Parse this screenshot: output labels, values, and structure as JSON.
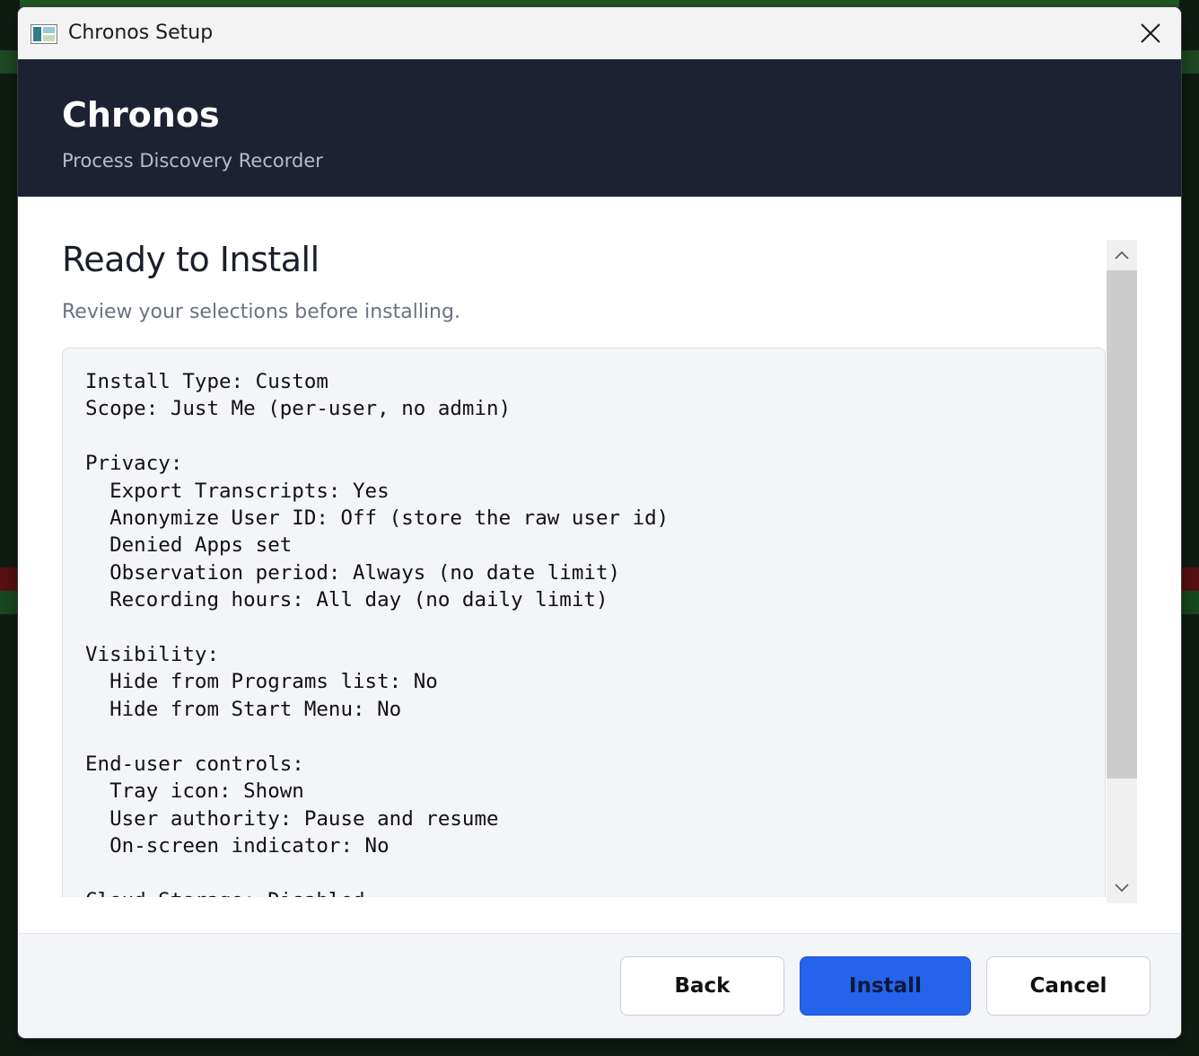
{
  "window": {
    "title": "Chronos Setup"
  },
  "header": {
    "app_name": "Chronos",
    "subtitle": "Process Discovery Recorder"
  },
  "page": {
    "title": "Ready to Install",
    "subtitle": "Review your selections before installing."
  },
  "summary": {
    "text": "Install Type: Custom\nScope: Just Me (per-user, no admin)\n\nPrivacy:\n  Export Transcripts: Yes\n  Anonymize User ID: Off (store the raw user id)\n  Denied Apps set\n  Observation period: Always (no date limit)\n  Recording hours: All day (no daily limit)\n\nVisibility:\n  Hide from Programs list: No\n  Hide from Start Menu: No\n\nEnd-user controls:\n  Tray icon: Shown\n  User authority: Pause and resume\n  On-screen indicator: No\n\nCloud Storage: Disabled"
  },
  "buttons": {
    "back": "Back",
    "install": "Install",
    "cancel": "Cancel"
  },
  "icons": {
    "app": "setup-app-icon",
    "close": "close-icon",
    "scroll_up": "chevron-up-icon",
    "scroll_down": "chevron-down-icon"
  },
  "colors": {
    "header_bg": "#1d2233",
    "accent": "#2563eb"
  }
}
